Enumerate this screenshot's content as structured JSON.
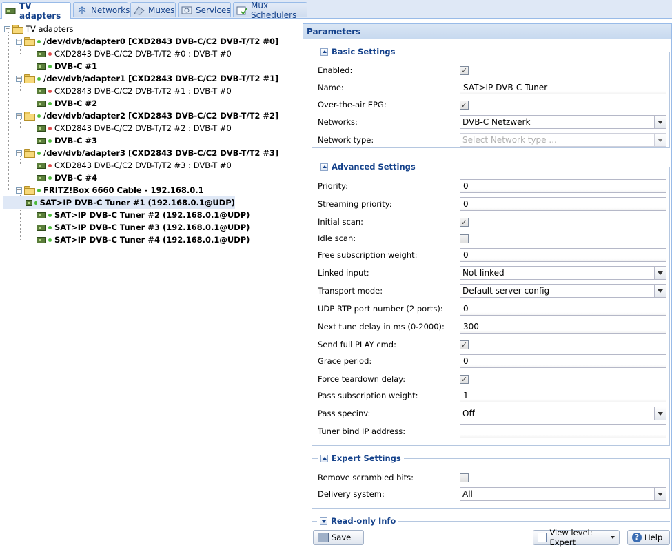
{
  "tabs": [
    {
      "label": "TV adapters",
      "icon": "tv-card-icon",
      "active": true
    },
    {
      "label": "Networks",
      "icon": "antenna-icon",
      "active": false
    },
    {
      "label": "Muxes",
      "icon": "mux-icon",
      "active": false
    },
    {
      "label": "Services",
      "icon": "tv-screen-icon",
      "active": false
    },
    {
      "label": "Mux Schedulers",
      "icon": "scheduler-icon",
      "active": false
    }
  ],
  "tree": {
    "root": "TV adapters",
    "adapters": [
      {
        "label": "/dev/dvb/adapter0 [CXD2843 DVB-C/C2 DVB-T/T2 #0]",
        "frontends": [
          {
            "label": "CXD2843 DVB-C/C2 DVB-T/T2 #0 : DVB-T #0",
            "status": "disabled"
          },
          {
            "label": "DVB-C #1",
            "status": "enabled"
          }
        ]
      },
      {
        "label": "/dev/dvb/adapter1 [CXD2843 DVB-C/C2 DVB-T/T2 #1]",
        "frontends": [
          {
            "label": "CXD2843 DVB-C/C2 DVB-T/T2 #1 : DVB-T #0",
            "status": "disabled"
          },
          {
            "label": "DVB-C #2",
            "status": "enabled"
          }
        ]
      },
      {
        "label": "/dev/dvb/adapter2 [CXD2843 DVB-C/C2 DVB-T/T2 #2]",
        "frontends": [
          {
            "label": "CXD2843 DVB-C/C2 DVB-T/T2 #2 : DVB-T #0",
            "status": "disabled"
          },
          {
            "label": "DVB-C #3",
            "status": "enabled"
          }
        ]
      },
      {
        "label": "/dev/dvb/adapter3 [CXD2843 DVB-C/C2 DVB-T/T2 #3]",
        "frontends": [
          {
            "label": "CXD2843 DVB-C/C2 DVB-T/T2 #3 : DVB-T #0",
            "status": "disabled"
          },
          {
            "label": "DVB-C #4",
            "status": "enabled"
          }
        ]
      },
      {
        "label": "FRITZ!Box 6660 Cable - 192.168.0.1",
        "frontends": [
          {
            "label": "SAT>IP DVB-C Tuner #1 (192.168.0.1@UDP)",
            "status": "enabled",
            "selected": true
          },
          {
            "label": "SAT>IP DVB-C Tuner #2 (192.168.0.1@UDP)",
            "status": "enabled"
          },
          {
            "label": "SAT>IP DVB-C Tuner #3 (192.168.0.1@UDP)",
            "status": "enabled"
          },
          {
            "label": "SAT>IP DVB-C Tuner #4 (192.168.0.1@UDP)",
            "status": "enabled"
          }
        ]
      }
    ]
  },
  "params": {
    "title": "Parameters",
    "basic": {
      "title": "Basic Settings",
      "enabled_label": "Enabled:",
      "enabled": true,
      "name_label": "Name:",
      "name": "SAT>IP DVB-C Tuner",
      "epg_label": "Over-the-air EPG:",
      "epg": true,
      "networks_label": "Networks:",
      "networks": "DVB-C Netzwerk",
      "nettype_label": "Network type:",
      "nettype_placeholder": "Select Network type ..."
    },
    "advanced": {
      "title": "Advanced Settings",
      "priority_label": "Priority:",
      "priority": "0",
      "streaming_label": "Streaming priority:",
      "streaming": "0",
      "initial_scan_label": "Initial scan:",
      "initial_scan": true,
      "idle_scan_label": "Idle scan:",
      "idle_scan": false,
      "free_weight_label": "Free subscription weight:",
      "free_weight": "0",
      "linked_label": "Linked input:",
      "linked": "Not linked",
      "transport_label": "Transport mode:",
      "transport": "Default server config",
      "udp_label": "UDP RTP port number (2 ports):",
      "udp": "0",
      "tune_delay_label": "Next tune delay in ms (0-2000):",
      "tune_delay": "300",
      "full_play_label": "Send full PLAY cmd:",
      "full_play": true,
      "grace_label": "Grace period:",
      "grace": "0",
      "teardown_label": "Force teardown delay:",
      "teardown": true,
      "pass_weight_label": "Pass subscription weight:",
      "pass_weight": "1",
      "specinv_label": "Pass specinv:",
      "specinv": "Off",
      "bind_ip_label": "Tuner bind IP address:",
      "bind_ip": ""
    },
    "expert": {
      "title": "Expert Settings",
      "scrambled_label": "Remove scrambled bits:",
      "scrambled": false,
      "delivery_label": "Delivery system:",
      "delivery": "All"
    },
    "readonly": {
      "title": "Read-only Info"
    }
  },
  "toolbar": {
    "save_label": "Save",
    "view_level_label": "View level: Expert",
    "help_label": "Help"
  },
  "colors": {
    "header_text": "#15428b",
    "border": "#99bbe8",
    "enabled_dot": "#4cbb3a",
    "disabled_dot": "#e04c4c"
  }
}
